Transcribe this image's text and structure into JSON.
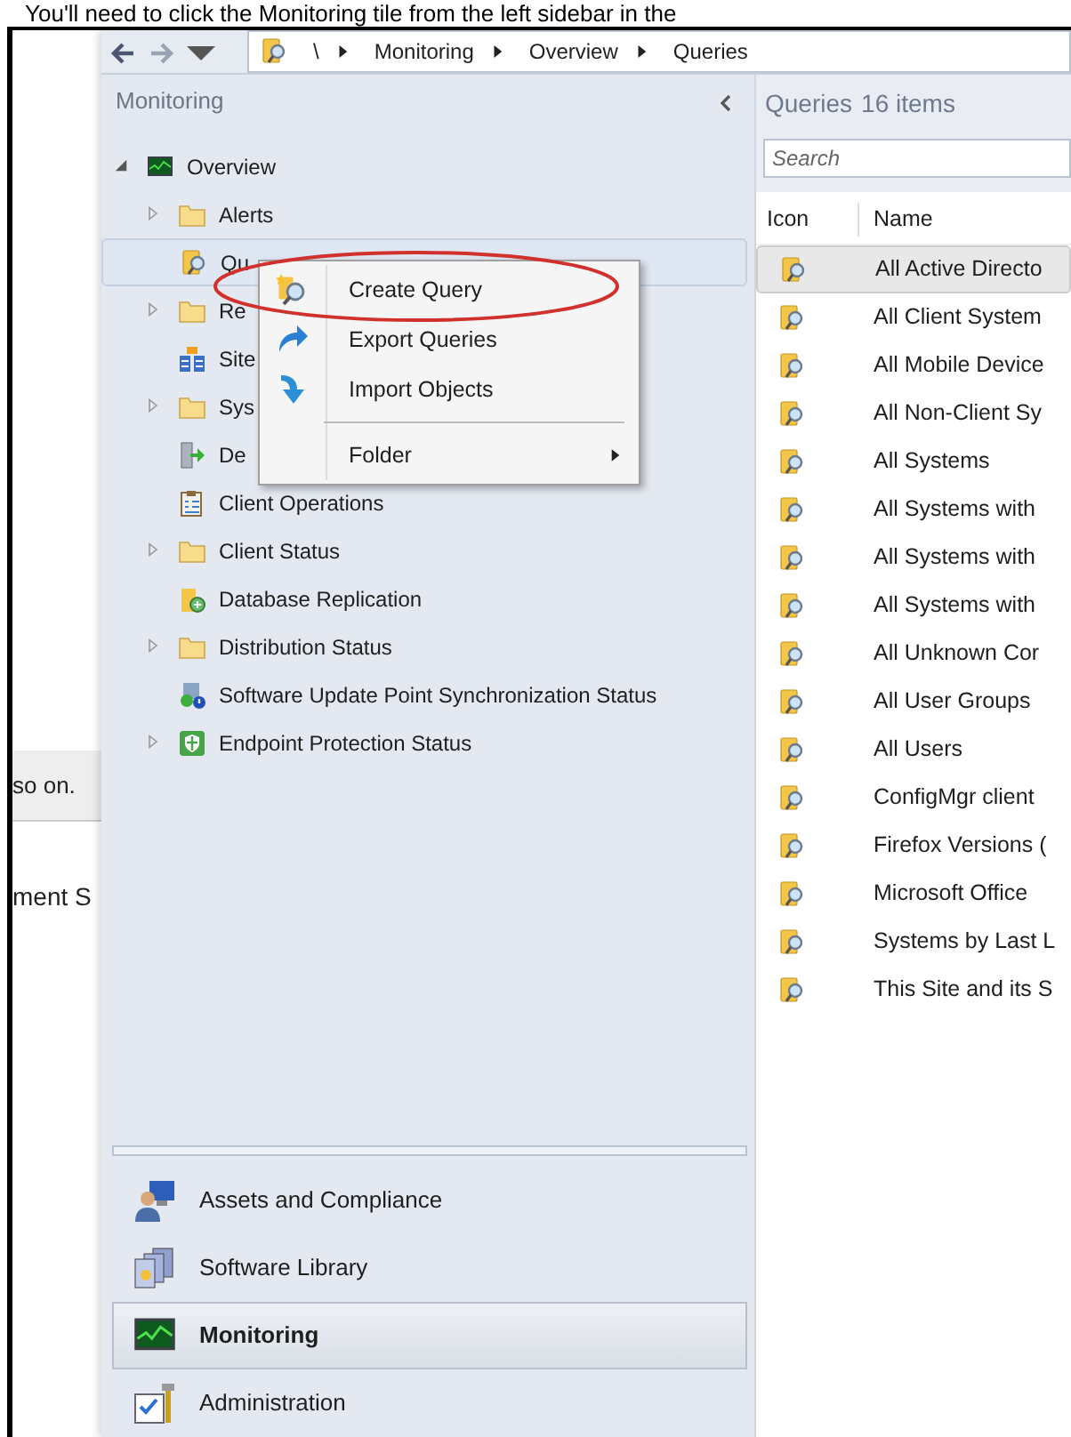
{
  "caption": "You'll need to click the Monitoring tile from the left sidebar in the",
  "background_page": {
    "texts": [
      "so on.",
      "ment S"
    ]
  },
  "toolbar": {
    "breadcrumb": [
      "\\",
      "Monitoring",
      "Overview",
      "Queries"
    ]
  },
  "nav_pane": {
    "title": "Monitoring",
    "tree": [
      {
        "label": "Overview",
        "kind": "monitor",
        "expandable": true,
        "expanded": true,
        "selected": false,
        "children": [
          {
            "label": "Alerts",
            "kind": "folder",
            "expandable": true,
            "expanded": false,
            "selected": false
          },
          {
            "label": "Qu",
            "kind": "query",
            "expandable": false,
            "selected": true
          },
          {
            "label": "Re",
            "kind": "folder",
            "expandable": true,
            "expanded": false,
            "selected": false
          },
          {
            "label": "Site",
            "kind": "site",
            "expandable": false,
            "selected": false
          },
          {
            "label": "Sys",
            "kind": "folder",
            "expandable": true,
            "expanded": false,
            "selected": false
          },
          {
            "label": "De",
            "kind": "deploy",
            "expandable": false,
            "selected": false
          },
          {
            "label": "Client Operations",
            "kind": "clipboard",
            "expandable": false,
            "selected": false
          },
          {
            "label": "Client Status",
            "kind": "folder",
            "expandable": true,
            "expanded": false,
            "selected": false
          },
          {
            "label": "Database Replication",
            "kind": "database",
            "expandable": false,
            "selected": false
          },
          {
            "label": "Distribution Status",
            "kind": "folder",
            "expandable": true,
            "expanded": false,
            "selected": false
          },
          {
            "label": "Software Update Point Synchronization Status",
            "kind": "update",
            "expandable": false,
            "selected": false
          },
          {
            "label": "Endpoint Protection Status",
            "kind": "shield",
            "expandable": true,
            "expanded": false,
            "selected": false
          }
        ]
      }
    ]
  },
  "context_menu": {
    "items": [
      {
        "label": "Create Query",
        "kind": "query-new",
        "separator_before": false,
        "submenu": false,
        "highlighted": true
      },
      {
        "label": "Export Queries",
        "kind": "export",
        "separator_before": false,
        "submenu": false,
        "highlighted": false
      },
      {
        "label": "Import Objects",
        "kind": "import",
        "separator_before": false,
        "submenu": false,
        "highlighted": false
      },
      {
        "label": "Folder",
        "kind": "plain",
        "separator_before": true,
        "submenu": true,
        "highlighted": false
      }
    ]
  },
  "results": {
    "title": "Queries",
    "count": "16 items",
    "search": {
      "placeholder": "Search"
    },
    "columns": [
      "Icon",
      "Name"
    ],
    "rows": [
      {
        "name": "All Active Directo",
        "selected": true
      },
      {
        "name": "All Client System",
        "selected": false
      },
      {
        "name": "All Mobile Device",
        "selected": false
      },
      {
        "name": "All Non-Client Sy",
        "selected": false
      },
      {
        "name": "All Systems",
        "selected": false
      },
      {
        "name": "All Systems with",
        "selected": false
      },
      {
        "name": "All Systems with",
        "selected": false
      },
      {
        "name": "All Systems with",
        "selected": false
      },
      {
        "name": "All Unknown Cor",
        "selected": false
      },
      {
        "name": "All User Groups",
        "selected": false
      },
      {
        "name": "All Users",
        "selected": false
      },
      {
        "name": "ConfigMgr client",
        "selected": false
      },
      {
        "name": "Firefox Versions (",
        "selected": false
      },
      {
        "name": "Microsoft Office",
        "selected": false
      },
      {
        "name": "Systems by Last L",
        "selected": false
      },
      {
        "name": "This Site and its S",
        "selected": false
      }
    ]
  },
  "workspaces": [
    {
      "label": "Assets and Compliance",
      "kind": "user-pc",
      "selected": false
    },
    {
      "label": "Software Library",
      "kind": "library",
      "selected": false
    },
    {
      "label": "Monitoring",
      "kind": "monitor",
      "selected": true
    },
    {
      "label": "Administration",
      "kind": "admin",
      "selected": false
    }
  ]
}
